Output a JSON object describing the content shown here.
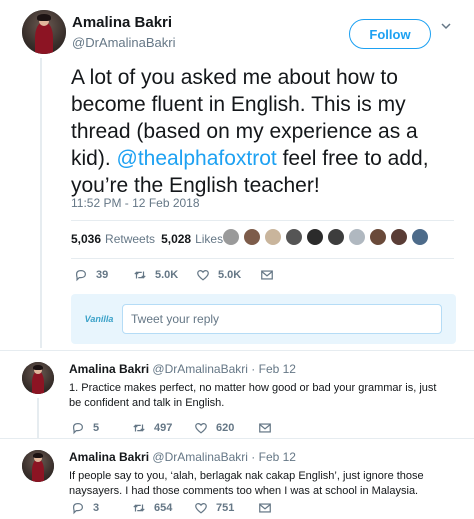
{
  "main_tweet": {
    "author_name": "Amalina Bakri",
    "author_handle": "@DrAmalinaBakri",
    "follow_label": "Follow",
    "text_before": "A lot of you asked me about how to become fluent in English. This is my thread (based on my experience as a kid). ",
    "mention": "@thealphafoxtrot",
    "text_after": " feel free to add, you’re the English teacher!",
    "timestamp": "11:52 PM - 12 Feb 2018",
    "retweets_count": "5,036",
    "retweets_label": "Retweets",
    "likes_count": "5,028",
    "likes_label": "Likes",
    "actions": {
      "replies": "39",
      "retweets": "5.0K",
      "likes": "5.0K"
    }
  },
  "reply_composer": {
    "logo_text": "Vanilla",
    "placeholder": "Tweet your reply"
  },
  "replies": [
    {
      "author_name": "Amalina Bakri",
      "author_handle": "@DrAmalinaBakri",
      "date": "· Feb 12",
      "text": "1. Practice makes perfect, no matter how good or bad your grammar is, just be confident and talk in English.",
      "replies": "5",
      "retweets": "497",
      "likes": "620"
    },
    {
      "author_name": "Amalina Bakri",
      "author_handle": "@DrAmalinaBakri",
      "date": "· Feb 12",
      "text": "If people say to you, ‘alah, berlagak nak cakap English’, just ignore those naysayers. I had those comments too when I was at school in Malaysia.",
      "replies": "3",
      "retweets": "654",
      "likes": "751"
    }
  ],
  "icons": {
    "reply": "reply-icon",
    "retweet": "retweet-icon",
    "like": "heart-icon",
    "dm": "envelope-icon",
    "caret": "chevron-down-icon"
  },
  "colors": {
    "accent": "#1da1f2",
    "muted": "#657786",
    "text": "#14171a",
    "divider": "#e6ecf0"
  }
}
